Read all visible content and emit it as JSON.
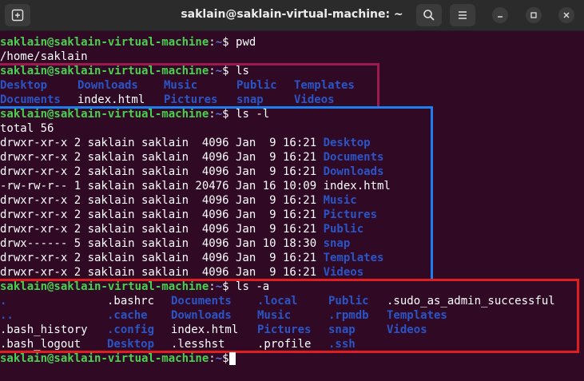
{
  "window": {
    "title": "saklain@saklain-virtual-machine: ~",
    "new_tab_icon": "new-tab-icon",
    "search_icon": "search-icon",
    "menu_icon": "hamburger-menu-icon"
  },
  "prompt": {
    "user_host": "saklain@saklain-virtual-machine",
    "sep": ":",
    "path": "~",
    "symbol": "$"
  },
  "colors": {
    "background": "#300a24",
    "prompt_user": "#4ad04f",
    "prompt_path": "#5b6fd6",
    "directory": "#2a55c8",
    "box_ls": "#9c1a4e",
    "box_ls_l": "#1e7ef0",
    "box_ls_a": "#e01d22"
  },
  "session": {
    "pwd": {
      "command": "pwd",
      "output": "/home/saklain"
    },
    "ls": {
      "command": "ls",
      "rows": [
        [
          {
            "t": "Desktop",
            "d": true
          },
          {
            "t": "Downloads",
            "d": true
          },
          {
            "t": "Music",
            "d": true
          },
          {
            "t": "Public",
            "d": true
          },
          {
            "t": "Templates",
            "d": true
          }
        ],
        [
          {
            "t": "Documents",
            "d": true
          },
          {
            "t": "index.html",
            "d": false
          },
          {
            "t": "Pictures",
            "d": true
          },
          {
            "t": "snap",
            "d": true
          },
          {
            "t": "Videos",
            "d": true
          }
        ]
      ]
    },
    "ls_l": {
      "command": "ls -l",
      "total": "total 56",
      "rows": [
        {
          "meta": "drwxr-xr-x 2 saklain saklain  4096 Jan  9 16:21 ",
          "name": "Desktop",
          "d": true
        },
        {
          "meta": "drwxr-xr-x 2 saklain saklain  4096 Jan  9 16:21 ",
          "name": "Documents",
          "d": true
        },
        {
          "meta": "drwxr-xr-x 2 saklain saklain  4096 Jan  9 16:21 ",
          "name": "Downloads",
          "d": true
        },
        {
          "meta": "-rw-rw-r-- 1 saklain saklain 20476 Jan 16 10:09 ",
          "name": "index.html",
          "d": false
        },
        {
          "meta": "drwxr-xr-x 2 saklain saklain  4096 Jan  9 16:21 ",
          "name": "Music",
          "d": true
        },
        {
          "meta": "drwxr-xr-x 2 saklain saklain  4096 Jan  9 16:21 ",
          "name": "Pictures",
          "d": true
        },
        {
          "meta": "drwxr-xr-x 2 saklain saklain  4096 Jan  9 16:21 ",
          "name": "Public",
          "d": true
        },
        {
          "meta": "drwx------ 5 saklain saklain  4096 Jan 10 18:30 ",
          "name": "snap",
          "d": true
        },
        {
          "meta": "drwxr-xr-x 2 saklain saklain  4096 Jan  9 16:21 ",
          "name": "Templates",
          "d": true
        },
        {
          "meta": "drwxr-xr-x 2 saklain saklain  4096 Jan  9 16:21 ",
          "name": "Videos",
          "d": true
        }
      ]
    },
    "ls_a": {
      "command": "ls -a",
      "rows": [
        [
          {
            "t": ".",
            "d": true
          },
          {
            "t": ".bashrc",
            "d": false
          },
          {
            "t": "Documents",
            "d": true
          },
          {
            "t": ".local",
            "d": true
          },
          {
            "t": "Public",
            "d": true
          },
          {
            "t": ".sudo_as_admin_successful",
            "d": false
          }
        ],
        [
          {
            "t": "..",
            "d": true
          },
          {
            "t": ".cache",
            "d": true
          },
          {
            "t": "Downloads",
            "d": true
          },
          {
            "t": "Music",
            "d": true
          },
          {
            "t": ".rpmdb",
            "d": true
          },
          {
            "t": "Templates",
            "d": true
          }
        ],
        [
          {
            "t": ".bash_history",
            "d": false
          },
          {
            "t": ".config",
            "d": true
          },
          {
            "t": "index.html",
            "d": false
          },
          {
            "t": "Pictures",
            "d": true
          },
          {
            "t": "snap",
            "d": true
          },
          {
            "t": "Videos",
            "d": true
          }
        ],
        [
          {
            "t": ".bash_logout",
            "d": false
          },
          {
            "t": "Desktop",
            "d": true
          },
          {
            "t": ".lesshst",
            "d": false
          },
          {
            "t": ".profile",
            "d": false
          },
          {
            "t": ".ssh",
            "d": true
          }
        ]
      ]
    }
  }
}
